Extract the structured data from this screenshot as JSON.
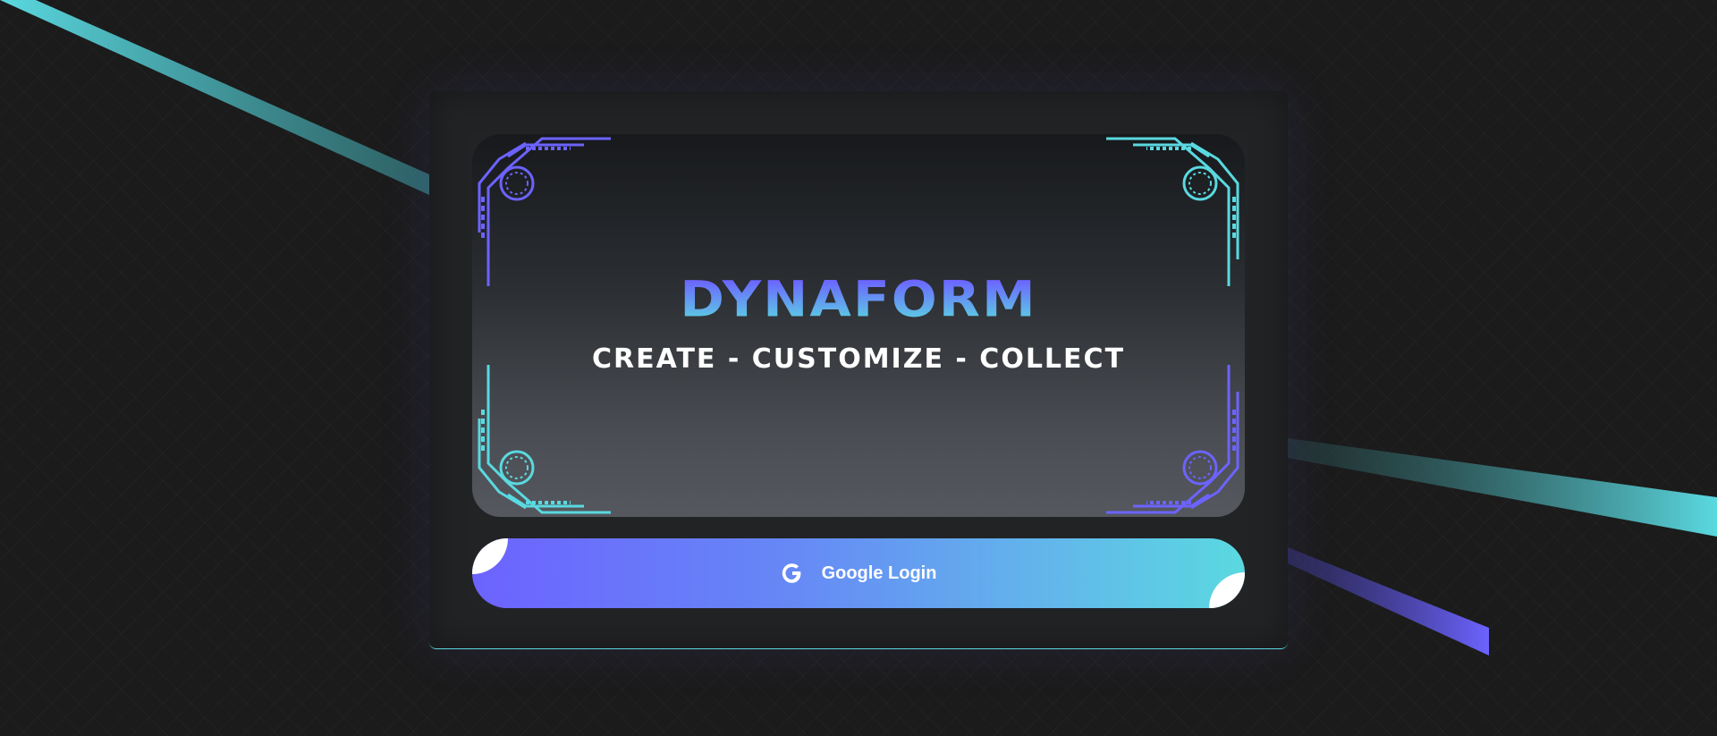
{
  "brand": {
    "title": "DYNAFORM",
    "tagline": "CREATE - CUSTOMIZE - COLLECT"
  },
  "login": {
    "label": "Google Login",
    "icon": "google-icon"
  },
  "colors": {
    "accent_purple": "#6c63ff",
    "accent_cyan": "#5ad9e0",
    "background": "#1b1b1b",
    "card": "#222325"
  }
}
